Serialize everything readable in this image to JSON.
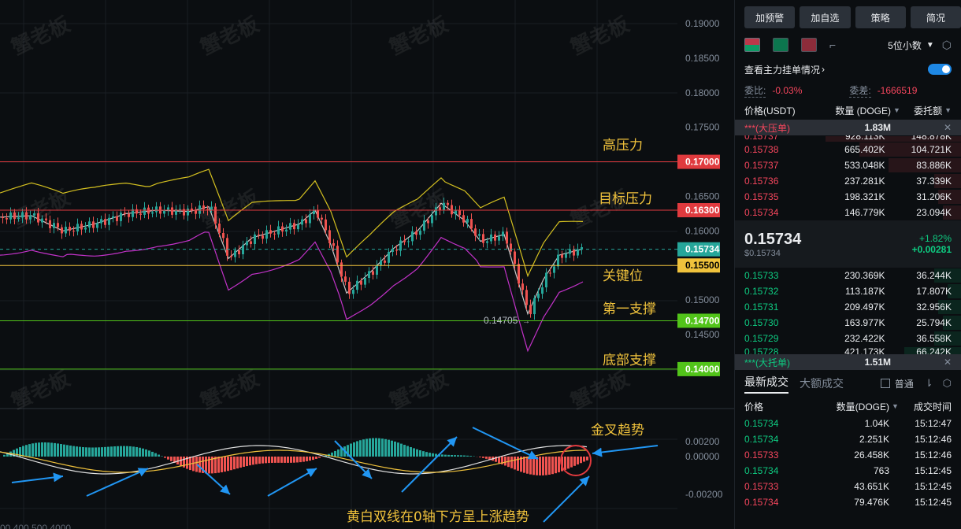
{
  "watermark": "蟹老板",
  "chart": {
    "y_axis_labels": [
      "0.19000",
      "0.18500",
      "0.18000",
      "0.17500",
      "0.16500",
      "0.16000",
      "0.15000",
      "0.14500"
    ],
    "macd_axis_labels": [
      "0.00200",
      "0.00000",
      "-0.00200"
    ],
    "levels": [
      {
        "name": "高压力",
        "price": "0.17000",
        "color": "#e03a3e",
        "label_color": "#ffffff"
      },
      {
        "name": "目标压力",
        "price": "0.16300",
        "color": "#e03a3e",
        "label_color": "#ffffff"
      },
      {
        "name": "",
        "price": "0.15734",
        "color": "#26a69a",
        "label_color": "#ffffff"
      },
      {
        "name": "关键位",
        "price": "0.15500",
        "color": "#f0c23c",
        "label_color": "#000000"
      },
      {
        "name": "第一支撑",
        "price": "0.14700",
        "color": "#52c41a",
        "label_color": "#ffffff"
      },
      {
        "name": "底部支撑",
        "price": "0.14000",
        "color": "#52c41a",
        "label_color": "#ffffff"
      }
    ],
    "low_marker": "0.14705",
    "macd_annotation": "金叉趋势",
    "bottom_annotation": "黄白双线在0轴下方呈上涨趋势",
    "bottom_cut_text": "00 400 500 4000"
  },
  "panel": {
    "top_buttons": [
      "加预警",
      "加自选",
      "策略",
      "简况"
    ],
    "decimal_select": "5位小数",
    "main_orders_link": "查看主力挂单情况",
    "toggle_on": true,
    "ratio_label": "委比:",
    "ratio_value": "-0.03%",
    "diff_label": "委差:",
    "diff_value": "-1666519",
    "headers": {
      "price": "价格(USDT)",
      "qty": "数量 (DOGE)",
      "amount": "委托额"
    },
    "big_sell_label": "***(大压单)",
    "big_sell_value": "1.83M",
    "asks_cut": {
      "price": "0.15737",
      "qty": "928.113K",
      "amt": "148.878K"
    },
    "asks": [
      {
        "price": "0.15738",
        "qty": "665.402K",
        "amt": "104.721K"
      },
      {
        "price": "0.15737",
        "qty": "533.048K",
        "amt": "83.886K"
      },
      {
        "price": "0.15736",
        "qty": "237.281K",
        "amt": "37.339K"
      },
      {
        "price": "0.15735",
        "qty": "198.321K",
        "amt": "31.206K"
      },
      {
        "price": "0.15734",
        "qty": "146.779K",
        "amt": "23.094K"
      }
    ],
    "last_price": "0.15734",
    "last_price_sub": "$0.15734",
    "change_pct": "+1.82%",
    "change_abs": "+0.00281",
    "bids": [
      {
        "price": "0.15733",
        "qty": "230.369K",
        "amt": "36.244K"
      },
      {
        "price": "0.15732",
        "qty": "113.187K",
        "amt": "17.807K"
      },
      {
        "price": "0.15731",
        "qty": "209.497K",
        "amt": "32.956K"
      },
      {
        "price": "0.15730",
        "qty": "163.977K",
        "amt": "25.794K"
      },
      {
        "price": "0.15729",
        "qty": "232.422K",
        "amt": "36.558K"
      }
    ],
    "bids_cut": {
      "price": "0.15728",
      "qty": "421.173K",
      "amt": "66.242K"
    },
    "big_buy_label": "***(大托单)",
    "big_buy_value": "1.51M",
    "trade_tabs": [
      "最新成交",
      "大额成交"
    ],
    "normal_label": "普通",
    "trade_headers": {
      "price": "价格",
      "qty": "数量(DOGE)",
      "time": "成交时间"
    },
    "trades": [
      {
        "price": "0.15734",
        "qty": "1.04K",
        "time": "15:12:47",
        "side": "buy"
      },
      {
        "price": "0.15734",
        "qty": "2.251K",
        "time": "15:12:46",
        "side": "buy"
      },
      {
        "price": "0.15733",
        "qty": "26.458K",
        "time": "15:12:46",
        "side": "sell"
      },
      {
        "price": "0.15734",
        "qty": "763",
        "time": "15:12:45",
        "side": "buy"
      },
      {
        "price": "0.15733",
        "qty": "43.651K",
        "time": "15:12:45",
        "side": "sell"
      },
      {
        "price": "0.15734",
        "qty": "79.476K",
        "time": "15:12:45",
        "side": "sell"
      }
    ]
  }
}
